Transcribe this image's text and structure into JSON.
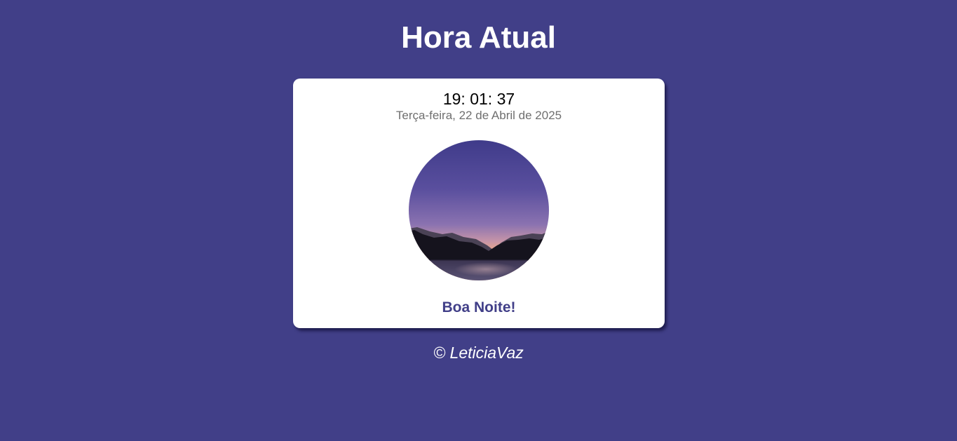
{
  "page": {
    "title": "Hora Atual",
    "background_color": "#413f88"
  },
  "clock": {
    "time": "19: 01: 37",
    "date": "Terça-feira, 22 de Abril de 2025",
    "greeting": "Boa Noite!",
    "greeting_color": "#413f88"
  },
  "image": {
    "icon": "night-landscape-image",
    "description_kind": "sunset-over-mountains-and-lake"
  },
  "footer": {
    "text": "© LeticiaVaz"
  }
}
